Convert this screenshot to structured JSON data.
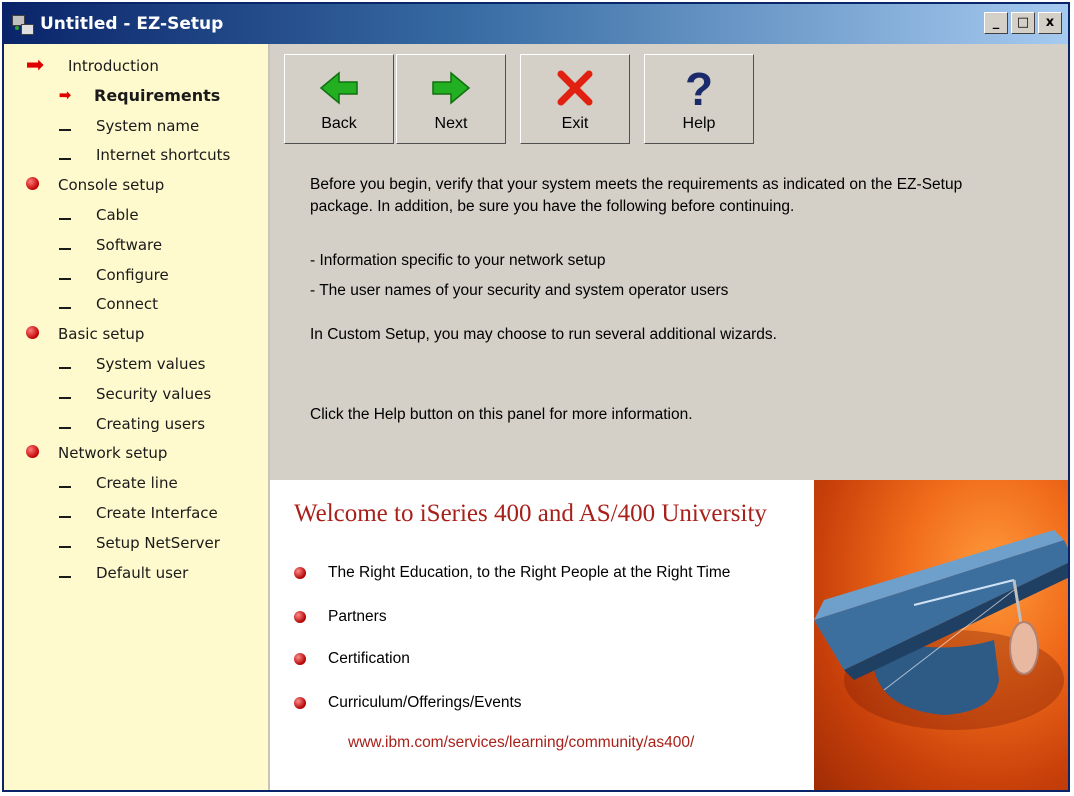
{
  "window": {
    "title": "Untitled - EZ-Setup",
    "controls": {
      "minimize": "_",
      "maximize": "□",
      "close": "x"
    }
  },
  "sidebar": {
    "items": [
      {
        "label": "Introduction",
        "kind": "section",
        "marker": "arrow-big"
      },
      {
        "label": "Requirements",
        "kind": "current",
        "marker": "arrow-small"
      },
      {
        "label": "System name",
        "kind": "sub",
        "marker": "dash"
      },
      {
        "label": "Internet shortcuts",
        "kind": "sub",
        "marker": "dash"
      },
      {
        "label": "Console setup",
        "kind": "section",
        "marker": "bullet"
      },
      {
        "label": "Cable",
        "kind": "sub",
        "marker": "dash"
      },
      {
        "label": "Software",
        "kind": "sub",
        "marker": "dash"
      },
      {
        "label": "Configure",
        "kind": "sub",
        "marker": "dash"
      },
      {
        "label": "Connect",
        "kind": "sub",
        "marker": "dash"
      },
      {
        "label": "Basic setup",
        "kind": "section",
        "marker": "bullet"
      },
      {
        "label": "System values",
        "kind": "sub",
        "marker": "dash"
      },
      {
        "label": "Security values",
        "kind": "sub",
        "marker": "dash"
      },
      {
        "label": "Creating users",
        "kind": "sub",
        "marker": "dash"
      },
      {
        "label": "Network setup",
        "kind": "section",
        "marker": "bullet"
      },
      {
        "label": "Create line",
        "kind": "sub",
        "marker": "dash"
      },
      {
        "label": "Create Interface",
        "kind": "sub",
        "marker": "dash"
      },
      {
        "label": "Setup NetServer",
        "kind": "sub",
        "marker": "dash"
      },
      {
        "label": "Default user",
        "kind": "sub",
        "marker": "dash"
      }
    ]
  },
  "toolbar": {
    "back_label": "Back",
    "next_label": "Next",
    "exit_label": "Exit",
    "help_label": "Help"
  },
  "content": {
    "paragraph1_line1": "Before you begin, verify that your system meets the requirements as indicated on the EZ-Setup",
    "paragraph1_line2": "package.  In addition, be sure you have the following before continuing.",
    "item1": "- Information specific to your network setup",
    "item2": "- The user names of your security and system operator users",
    "custom_note": "In Custom Setup, you may choose to run several additional wizards.",
    "help_note": "Click the Help button on this panel for more information."
  },
  "promo": {
    "title": "Welcome to iSeries 400 and AS/400 University",
    "items": [
      "The Right Education, to the Right People at the Right Time",
      "Partners",
      "Certification",
      "Curriculum/Offerings/Events"
    ],
    "url": "www.ibm.com/services/learning/community/as400/"
  },
  "colors": {
    "sidebar_bg": "#fffacd",
    "panel_bg": "#d4d0c8",
    "promo_red": "#a8201a",
    "arrow_green": "#22b022",
    "exit_red": "#e02010",
    "help_navy": "#1a2a6a"
  }
}
